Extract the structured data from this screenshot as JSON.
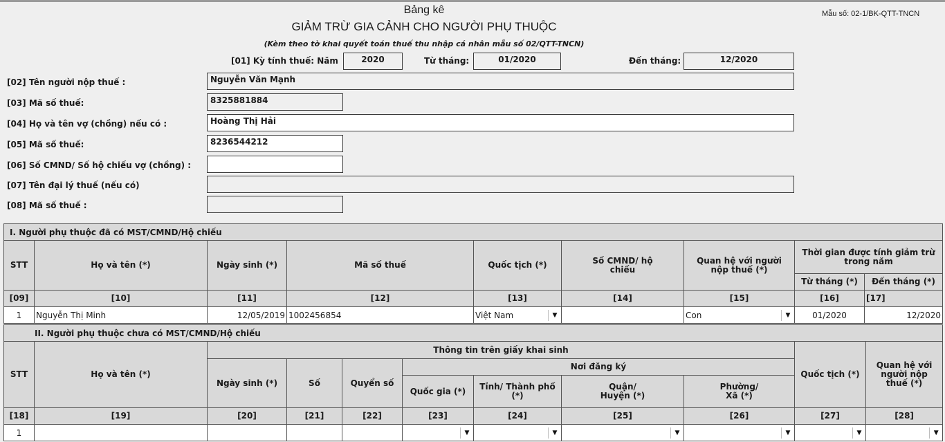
{
  "header": {
    "title_line1": "Bảng kê",
    "title_line2": "GIẢM TRỪ GIA CẢNH CHO NGƯỜI PHỤ THUỘC",
    "subtitle": "(Kèm theo tờ khai quyết toán thuế thu nhập cá nhân  mẫu số 02/QTT-TNCN)",
    "form_code": "Mẫu số: 02-1/BK-QTT-TNCN"
  },
  "period": {
    "label": "[01] Kỳ tính thuế: Năm",
    "year": "2020",
    "from_label": "Từ tháng:",
    "from_value": "01/2020",
    "to_label": "Đến tháng:",
    "to_value": "12/2020"
  },
  "fields": [
    {
      "label": "[02]  Tên người nộp thuế :",
      "value": "Nguyễn Văn Mạnh"
    },
    {
      "label": "[03]   Mã số thuế:",
      "value": "8325881884"
    },
    {
      "label": "[04]  Họ và tên vợ (chồng) nếu có :",
      "value": "Hoàng Thị Hải"
    },
    {
      "label": "[05]   Mã số thuế:",
      "value": "8236544212"
    },
    {
      "label": "[06]  Số CMND/ Số hộ chiếu vợ (chồng) :",
      "value": ""
    },
    {
      "label": "[07]  Tên đại lý thuế (nếu có)",
      "value": ""
    },
    {
      "label": "[08]  Mã số thuế :",
      "value": ""
    }
  ],
  "section1": {
    "title": "I. Người phụ thuộc đã có MST/CMND/Hộ chiếu",
    "headers": {
      "stt": "STT",
      "name": "Họ và tên (*)",
      "dob": "Ngày sinh (*)",
      "tax_code": "Mã số thuế",
      "nationality": "Quốc tịch (*)",
      "id_card": "Số CMND/ hộ chiếu",
      "relation": "Quan hệ với người nộp thuế (*)",
      "period": "Thời gian được tính giảm trừ trong năm",
      "from_month": "Từ tháng (*)",
      "to_month": "Đến tháng (*)"
    },
    "codes": [
      "[09]",
      "[10]",
      "[11]",
      "[12]",
      "[13]",
      "[14]",
      "[15]",
      "[16]",
      "[17]"
    ],
    "rows": [
      {
        "stt": "1",
        "name": "Nguyễn Thị Minh",
        "dob": "12/05/2019",
        "tax_code": "1002456854",
        "nationality": "Việt Nam",
        "id_card": "",
        "relation": "Con",
        "from_month": "01/2020",
        "to_month": "12/2020"
      }
    ]
  },
  "section2": {
    "title": "II. Người phụ thuộc chưa có MST/CMND/Hộ chiếu",
    "headers": {
      "stt": "STT",
      "name": "Họ và tên (*)",
      "birth_cert_info": "Thông tin trên giấy khai sinh",
      "dob": "Ngày sinh (*)",
      "number": "Số",
      "book": "Quyển số",
      "registration_place": "Nơi đăng ký",
      "country": "Quốc gia (*)",
      "province": "Tỉnh/ Thành phố (*)",
      "district": "Quận/ Huyện (*)",
      "ward": "Phường/ Xã (*)",
      "nationality": "Quốc tịch (*)",
      "relation": "Quan hệ với người nộp thuế (*)"
    },
    "codes": [
      "[18]",
      "[19]",
      "[20]",
      "[21]",
      "[22]",
      "[23]",
      "[24]",
      "[25]",
      "[26]",
      "[27]",
      "[28]"
    ],
    "rows": [
      {
        "stt": "1"
      }
    ]
  }
}
